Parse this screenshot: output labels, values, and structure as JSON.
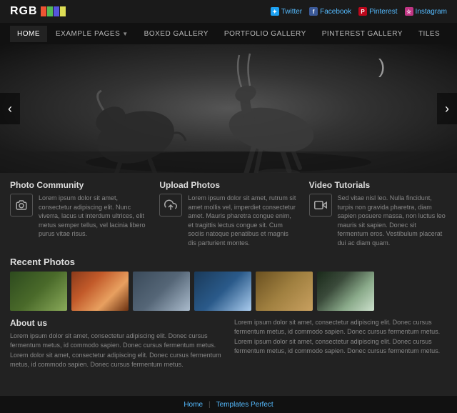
{
  "header": {
    "logo_text": "RGB",
    "social": [
      {
        "name": "Twitter",
        "icon": "T",
        "class": "twitter-icon"
      },
      {
        "name": "Facebook",
        "icon": "f",
        "class": "facebook-icon"
      },
      {
        "name": "Pinterest",
        "icon": "P",
        "class": "pinterest-icon"
      },
      {
        "name": "Instagram",
        "icon": "I",
        "class": "instagram-icon"
      }
    ]
  },
  "nav": {
    "items": [
      {
        "label": "HOME",
        "active": true,
        "has_dropdown": false
      },
      {
        "label": "EXAMPLE PAGES",
        "active": false,
        "has_dropdown": true
      },
      {
        "label": "BOXED GALLERY",
        "active": false,
        "has_dropdown": false
      },
      {
        "label": "PORTFOLIO GALLERY",
        "active": false,
        "has_dropdown": false
      },
      {
        "label": "PINTEREST GALLERY",
        "active": false,
        "has_dropdown": false
      },
      {
        "label": "TILES",
        "active": false,
        "has_dropdown": false
      }
    ]
  },
  "hero": {
    "prev_label": "‹",
    "next_label": "›"
  },
  "features": [
    {
      "title": "Photo Community",
      "icon": "camera",
      "text": "Lorem ipsum dolor sit amet, consectetur adipiscing elit. Nunc viverra, lacus ut interdum ultrices, elit metus semper tellus, vel lacinia libero purus vitae risus."
    },
    {
      "title": "Upload Photos",
      "icon": "upload",
      "text": "Lorem ipsum dolor sit amet, rutrum sit amet mollis vel, imperdiet consectetur amet. Mauris pharetra congue enim, et tragittis lectus congue sit. Cum sociis natoque penatibus et magnis dis parturient montes."
    },
    {
      "title": "Video Tutorials",
      "icon": "video",
      "text": "Sed vitae nisl leo. Nulla fincidunt, turpis non gravida pharetra, diam sapien posuere massa, non luctus leo mauris sit sapien. Donec sit fermentum eros. Vestibulum placerat dui ac diam quam."
    }
  ],
  "recent": {
    "title": "Recent Photos",
    "photos": [
      1,
      2,
      3,
      4,
      5,
      6
    ]
  },
  "about": {
    "title": "About us",
    "col1": "Lorem ipsum dolor sit amet, consectetur adipiscing elit. Donec cursus fermentum metus, id commodo sapien. Donec cursus fermentum metus.\nLorem dolor sit amet, consectetur adipiscing elit. Donec cursus fermentum metus, id commodo sapien. Donec cursus fermentum metus.",
    "col2": "Lorem ipsum dolor sit amet, consectetur adipiscing elit. Donec cursus fermentum metus, id commodo sapien. Donec cursus fermentum metus.\nLorem ipsum dolor sit amet, consectetur adipiscing elit. Donec cursus fermentum metus, id commodo sapien. Donec cursus fermentum metus."
  },
  "footer": {
    "links": [
      "Home",
      "Templates Perfect"
    ]
  }
}
